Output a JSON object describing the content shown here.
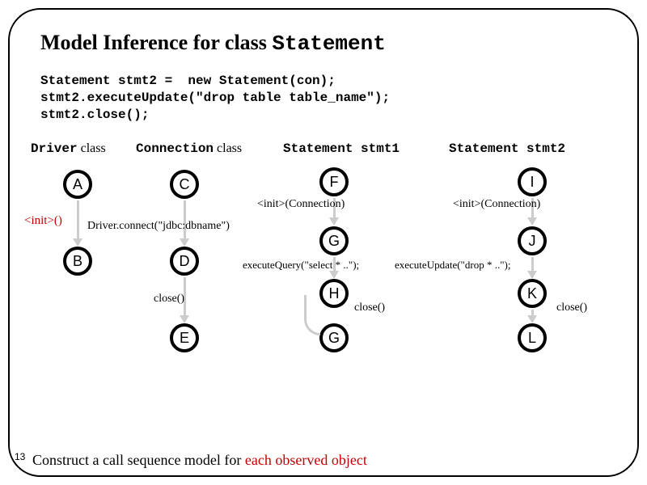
{
  "title_prefix": "Model Inference for class ",
  "title_classname": "Statement",
  "code": {
    "l1": "Statement stmt2 =  new Statement(con);",
    "l2": "stmt2.executeUpdate(\"drop table table_name\");",
    "l3": "stmt2.close();"
  },
  "columns": {
    "c1_a": "Driver",
    "c1_b": " class",
    "c2_a": "Connection",
    "c2_b": " class",
    "c3_a": "Statement",
    "c3_b": " stmt1",
    "c4_a": "Statement",
    "c4_b": " stmt2"
  },
  "nodes": {
    "A": "A",
    "B": "B",
    "C": "C",
    "D": "D",
    "E": "E",
    "F": "F",
    "G": "G",
    "H": "H",
    "G2": "G",
    "I": "I",
    "J": "J",
    "K": "K",
    "L": "L"
  },
  "labels": {
    "init_a": "<init>()",
    "driver_connect": "Driver.connect(\"jdbc:dbname\")",
    "close": "close()",
    "init_conn": "<init>(Connection)",
    "execQuery": "executeQuery(\"select * ..\");",
    "execUpdate": "executeUpdate(\"drop * ..\");",
    "close2": "close()"
  },
  "footer_a": "Construct a call sequence model for ",
  "footer_b": "each observed object",
  "pagenum": "13"
}
